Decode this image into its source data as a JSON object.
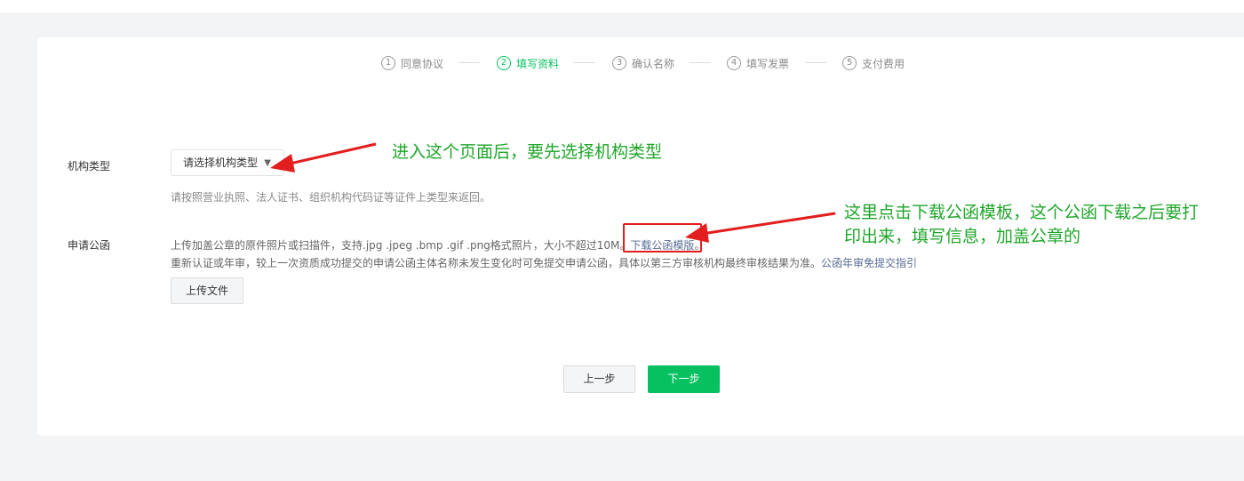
{
  "steps": [
    {
      "num": "1",
      "label": "同意协议"
    },
    {
      "num": "2",
      "label": "填写资料"
    },
    {
      "num": "3",
      "label": "确认名称"
    },
    {
      "num": "4",
      "label": "填写发票"
    },
    {
      "num": "5",
      "label": "支付费用"
    }
  ],
  "active_step": 2,
  "org_type": {
    "label": "机构类型",
    "select_value": "请选择机构类型",
    "hint": "请按照营业执照、法人证书、组织机构代码证等证件上类型来返回。"
  },
  "letter": {
    "label": "申请公函",
    "hint_line1": "上传加盖公章的原件照片或扫描件，支持.jpg .jpeg .bmp .gif .png格式照片，大小不超过10M。",
    "download_link": "下载公函模版",
    "download_suffix": "。",
    "hint_line2": "重新认证或年审，较上一次资质成功提交的申请公函主体名称未发生变化时可免提交申请公函，具体以第三方审核机构最终审核结果为准。",
    "guide_link": "公函年审免提交指引",
    "upload_button": "上传文件"
  },
  "buttons": {
    "prev": "上一步",
    "next": "下一步"
  },
  "annotations": {
    "select_note": "进入这个页面后，要先选择机构类型",
    "download_note_line1": "这里点击下载公函模板，这个公函下载之后要打",
    "download_note_line2": "印出来，填写信息，加盖公章的"
  },
  "colors": {
    "primary": "#07c160",
    "annotation_text": "#1fa62a",
    "annotation_mark": "#e21e1e",
    "link": "#576b95"
  }
}
